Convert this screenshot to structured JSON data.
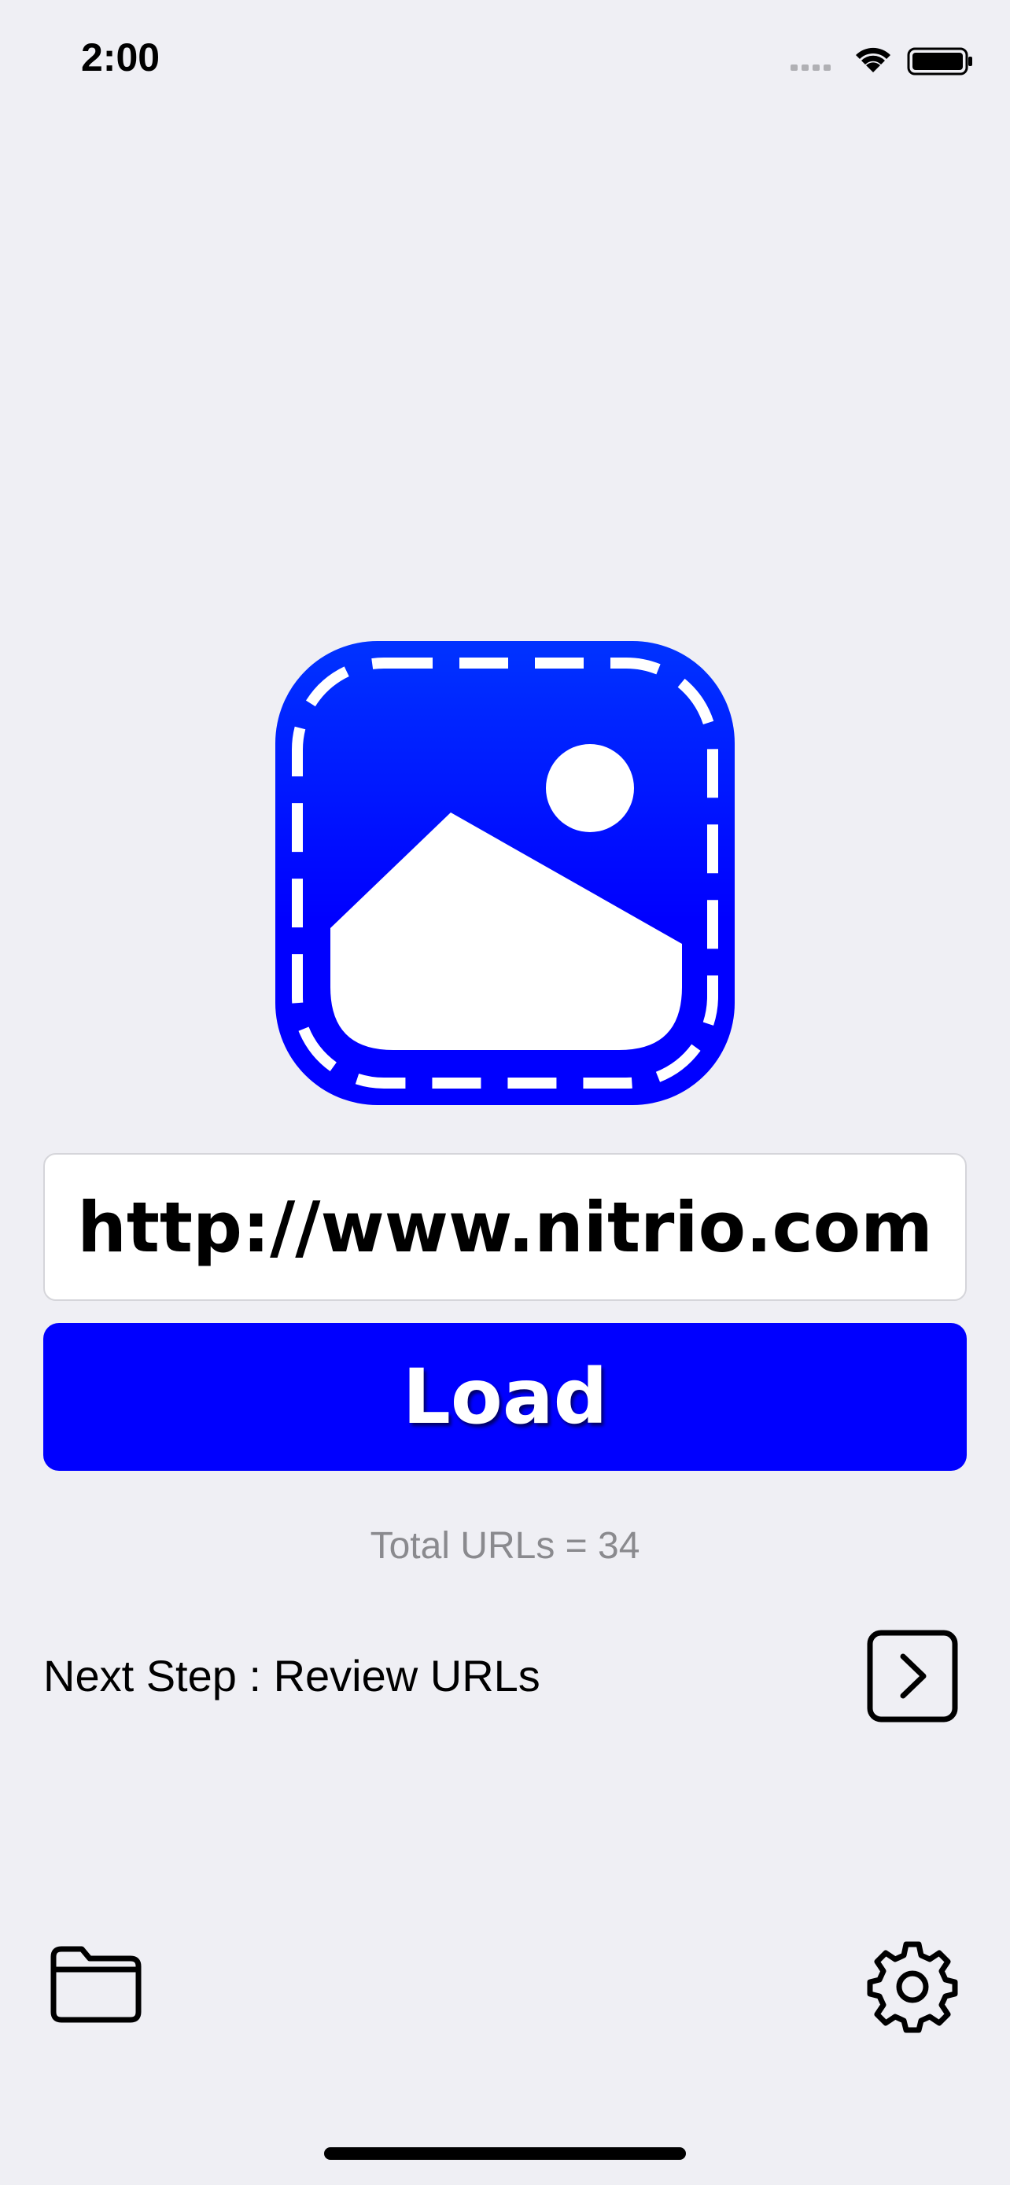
{
  "status_bar": {
    "time": "2:00"
  },
  "url_input": {
    "value": "http://www.nitrio.com"
  },
  "load_button": {
    "label": "Load"
  },
  "summary": {
    "total_urls_text": "Total URLs = 34"
  },
  "next_step": {
    "label": "Next Step : Review URLs",
    "icon": "chevron-right-square-icon"
  },
  "toolbar": {
    "left_icon": "folder-icon",
    "right_icon": "gear-icon"
  },
  "colors": {
    "accent": "#0000ff",
    "background": "#efeff4",
    "logo_gradient_top": "#0033ff",
    "logo_gradient_bottom": "#0000ff"
  }
}
